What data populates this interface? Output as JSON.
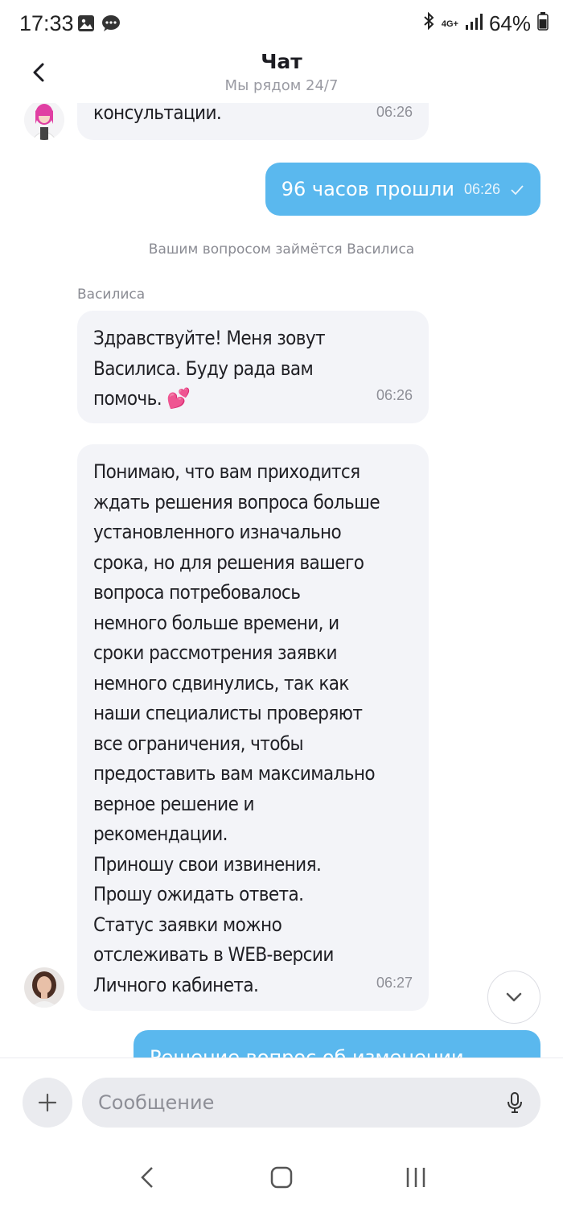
{
  "status_bar": {
    "time": "17:33",
    "network_top": "4G+",
    "battery": "64%",
    "left_icons": [
      "image-icon",
      "chat-bubble-icon"
    ],
    "right_icons": [
      "bluetooth-icon",
      "signal-icon",
      "battery-icon"
    ]
  },
  "header": {
    "title": "Чат",
    "subtitle": "Мы рядом 24/7"
  },
  "messages": {
    "m1": {
      "text": "консультации.",
      "time": "06:26"
    },
    "m2": {
      "text": "96 часов прошли",
      "time": "06:26"
    },
    "system": "Вашим вопросом займётся Василиса",
    "sender": "Василиса",
    "m3": {
      "text": "Здравствуйте! Меня зовут\nВасилиса. Буду рада вам\nпомочь. 💕",
      "time": "06:26"
    },
    "m4": {
      "text": "Понимаю, что вам приходится\nждать решения вопроса больше\nустановленного изначально\nсрока, но для решения вашего\nвопроса потребовалось\nнемного больше времени, и\nсроки рассмотрения заявки\nнемного сдвинулись, так как\nнаши специалисты проверяют\nвсе ограничения, чтобы\nпредоставить вам максимально\nверное решение и\nрекомендации.\nПриношу свои извинения.\nПрошу ожидать ответа.\nСтатус заявки можно\nотслеживать в WEB-версии\nЛичного кабинета.",
      "time": "06:27"
    },
    "m5_partial": "Решение вопрос об изменении"
  },
  "composer": {
    "placeholder": "Сообщение"
  },
  "colors": {
    "outgoing_bubble": "#5ab8ee",
    "incoming_bubble": "#f3f4f8",
    "avatar_bot": "#e03fa3"
  }
}
